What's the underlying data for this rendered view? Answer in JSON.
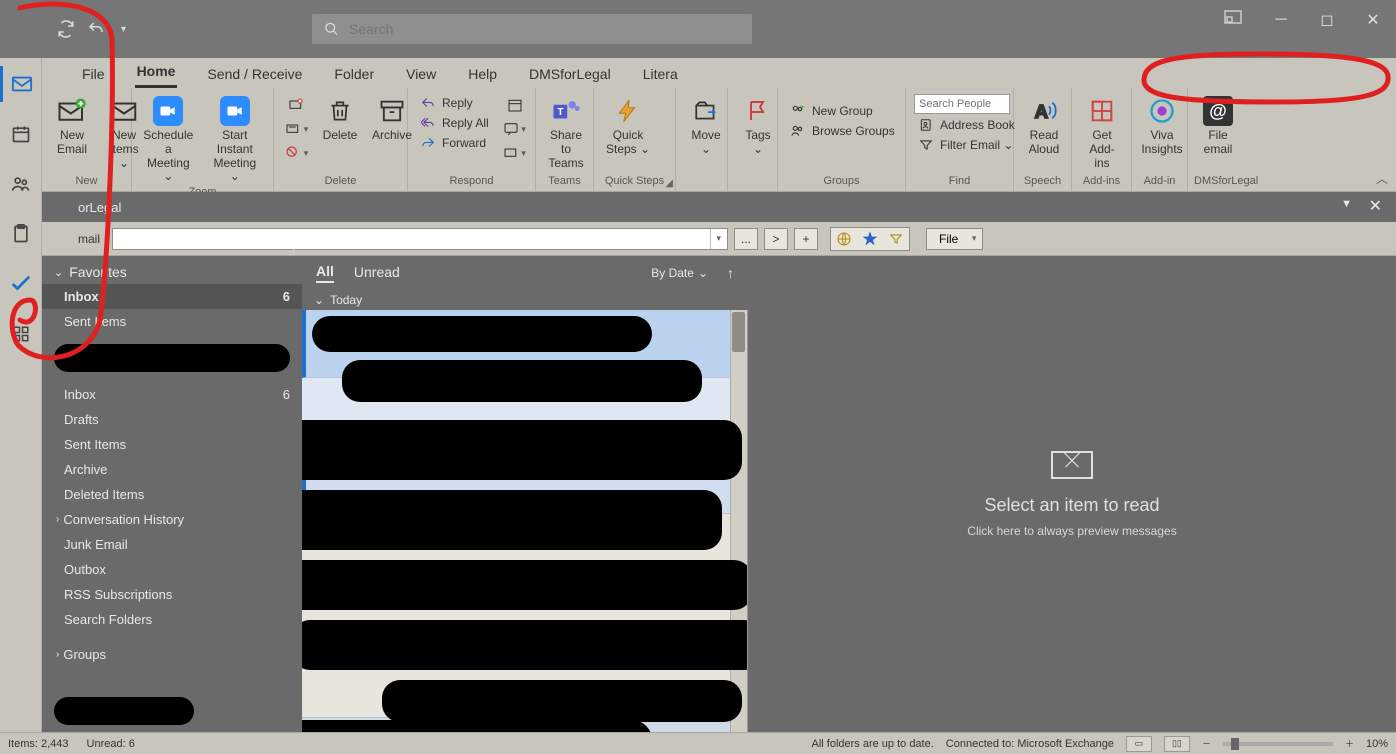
{
  "titlebar": {
    "search_placeholder": "Search"
  },
  "tabs": [
    "File",
    "Home",
    "Send / Receive",
    "Folder",
    "View",
    "Help",
    "DMSforLegal",
    "Litera"
  ],
  "active_tab": "Home",
  "ribbon": {
    "new": {
      "group": "New",
      "new_email": "New\nEmail",
      "new_items": "New\nItems ⌄"
    },
    "zoom": {
      "group": "Zoom",
      "schedule": "Schedule a\nMeeting ⌄",
      "start": "Start Instant\nMeeting ⌄"
    },
    "delete": {
      "group": "Delete",
      "delete": "Delete",
      "archive": "Archive"
    },
    "respond": {
      "group": "Respond",
      "reply": "Reply",
      "reply_all": "Reply All",
      "forward": "Forward"
    },
    "teams": {
      "group": "Teams",
      "share": "Share to\nTeams"
    },
    "quick": {
      "group": "Quick Steps",
      "qs": "Quick\nSteps ⌄"
    },
    "move": {
      "btn": "Move\n⌄"
    },
    "tags": {
      "btn": "Tags\n⌄"
    },
    "groups": {
      "group": "Groups",
      "new_group": "New Group",
      "browse": "Browse Groups"
    },
    "find": {
      "group": "Find",
      "search_ph": "Search People",
      "ab": "Address Book",
      "filter": "Filter Email ⌄"
    },
    "speech": {
      "group": "Speech",
      "read": "Read\nAloud"
    },
    "addins": {
      "group": "Add-ins",
      "get": "Get\nAdd-ins"
    },
    "addin": {
      "group": "Add-in",
      "viva": "Viva\nInsights"
    },
    "dms": {
      "group": "DMSforLegal",
      "file": "File\nemail"
    }
  },
  "dms_panel": {
    "title": "orLegal",
    "label": "mail",
    "file_btn": "File"
  },
  "nav": {
    "favorites": "Favorites",
    "fav_items": [
      {
        "label": "Inbox",
        "count": "6",
        "sel": true
      },
      {
        "label": "Sent Items"
      }
    ],
    "folders": [
      {
        "label": "Inbox",
        "count": "6"
      },
      {
        "label": "Drafts"
      },
      {
        "label": "Sent Items"
      },
      {
        "label": "Archive"
      },
      {
        "label": "Deleted Items"
      },
      {
        "label": "Conversation History",
        "exp": true
      },
      {
        "label": "Junk Email"
      },
      {
        "label": "Outbox"
      },
      {
        "label": "RSS Subscriptions"
      },
      {
        "label": "Search Folders"
      }
    ],
    "groups": "Groups"
  },
  "msglist": {
    "tabs": [
      "All",
      "Unread"
    ],
    "sort": "By Date",
    "group": "Today"
  },
  "reading": {
    "title": "Select an item to read",
    "sub": "Click here to always preview messages"
  },
  "status": {
    "items": "Items: 2,443",
    "unread": "Unread: 6",
    "sync": "All folders are up to date.",
    "conn": "Connected to: Microsoft Exchange",
    "zoom": "10%"
  },
  "small_btns": {
    "dots": "...",
    "gt": ">",
    "plus": "+"
  }
}
